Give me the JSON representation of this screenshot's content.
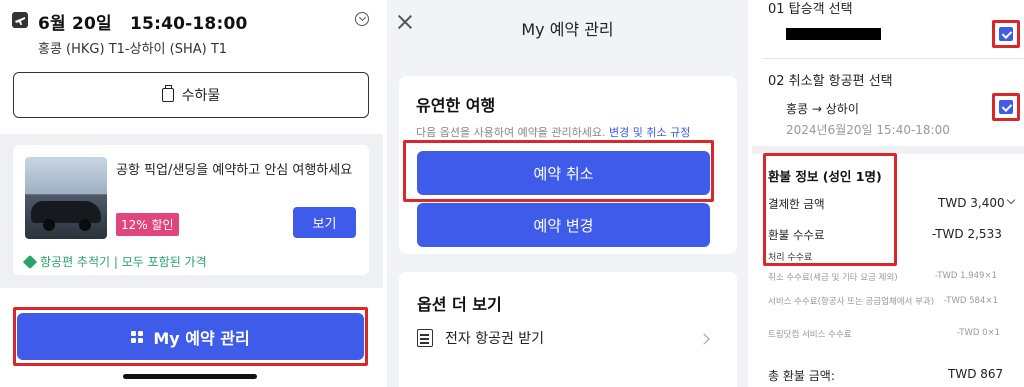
{
  "panel1": {
    "flight_date": "6월 20일",
    "flight_time": "15:40-18:00",
    "route": "홍콩 (HKG) T1-상하이 (SHA) T1",
    "baggage_label": "수하물",
    "promo_text": "공항 픽업/샌딩을 예약하고 안심 여행하세요",
    "discount_badge": "12% 할인",
    "view_button": "보기",
    "tracker_text": "항공편 추적기 | 모두 포함된 가격",
    "manage_button": "My 예약 관리"
  },
  "panel2": {
    "title": "My 예약 관리",
    "section_title": "유연한 여행",
    "description": "다음 옵션을 사용하여 예약을 관리하세요.",
    "description_link": "변경 및 취소 규정",
    "cancel_button": "예약 취소",
    "change_button": "예약 변경",
    "more_options_title": "옵션 더 보기",
    "eticket_label": "전자 항공권 받기"
  },
  "panel3": {
    "step1_label": "01 탑승객 선택",
    "step2_label": "02 취소할 항공편 선택",
    "flight_route": "홍콩 → 상하이",
    "flight_datetime": "2024년6월20일  15:40-18:00",
    "refund_title": "환불 정보 (성인 1명)",
    "paid_label": "결제한 금액",
    "paid_value": "TWD 3,400",
    "refund_fee_label": "환불 수수료",
    "refund_fee_value": "-TWD 2,533",
    "processing_fee_label": "처리 수수료",
    "cancel_fee_label": "취소 수수료(세금 및 기타 요금 제외)",
    "cancel_fee_value": "-TWD 1,949×1",
    "service_fee_label": "서비스 수수료(항공사 또는 공급업체에서 부과)",
    "service_fee_value": "-TWD 584×1",
    "trip_fee_label": "트립닷컴 서비스 수수료",
    "trip_fee_value": "-TWD 0×1",
    "total_refund_label": "총 환불 금액:",
    "total_refund_value": "TWD 867"
  },
  "colors": {
    "accent_blue": "#3e5bea",
    "highlight_red": "#d8282c",
    "discount_pink": "#e0457b",
    "tracker_green": "#2aa36b"
  }
}
